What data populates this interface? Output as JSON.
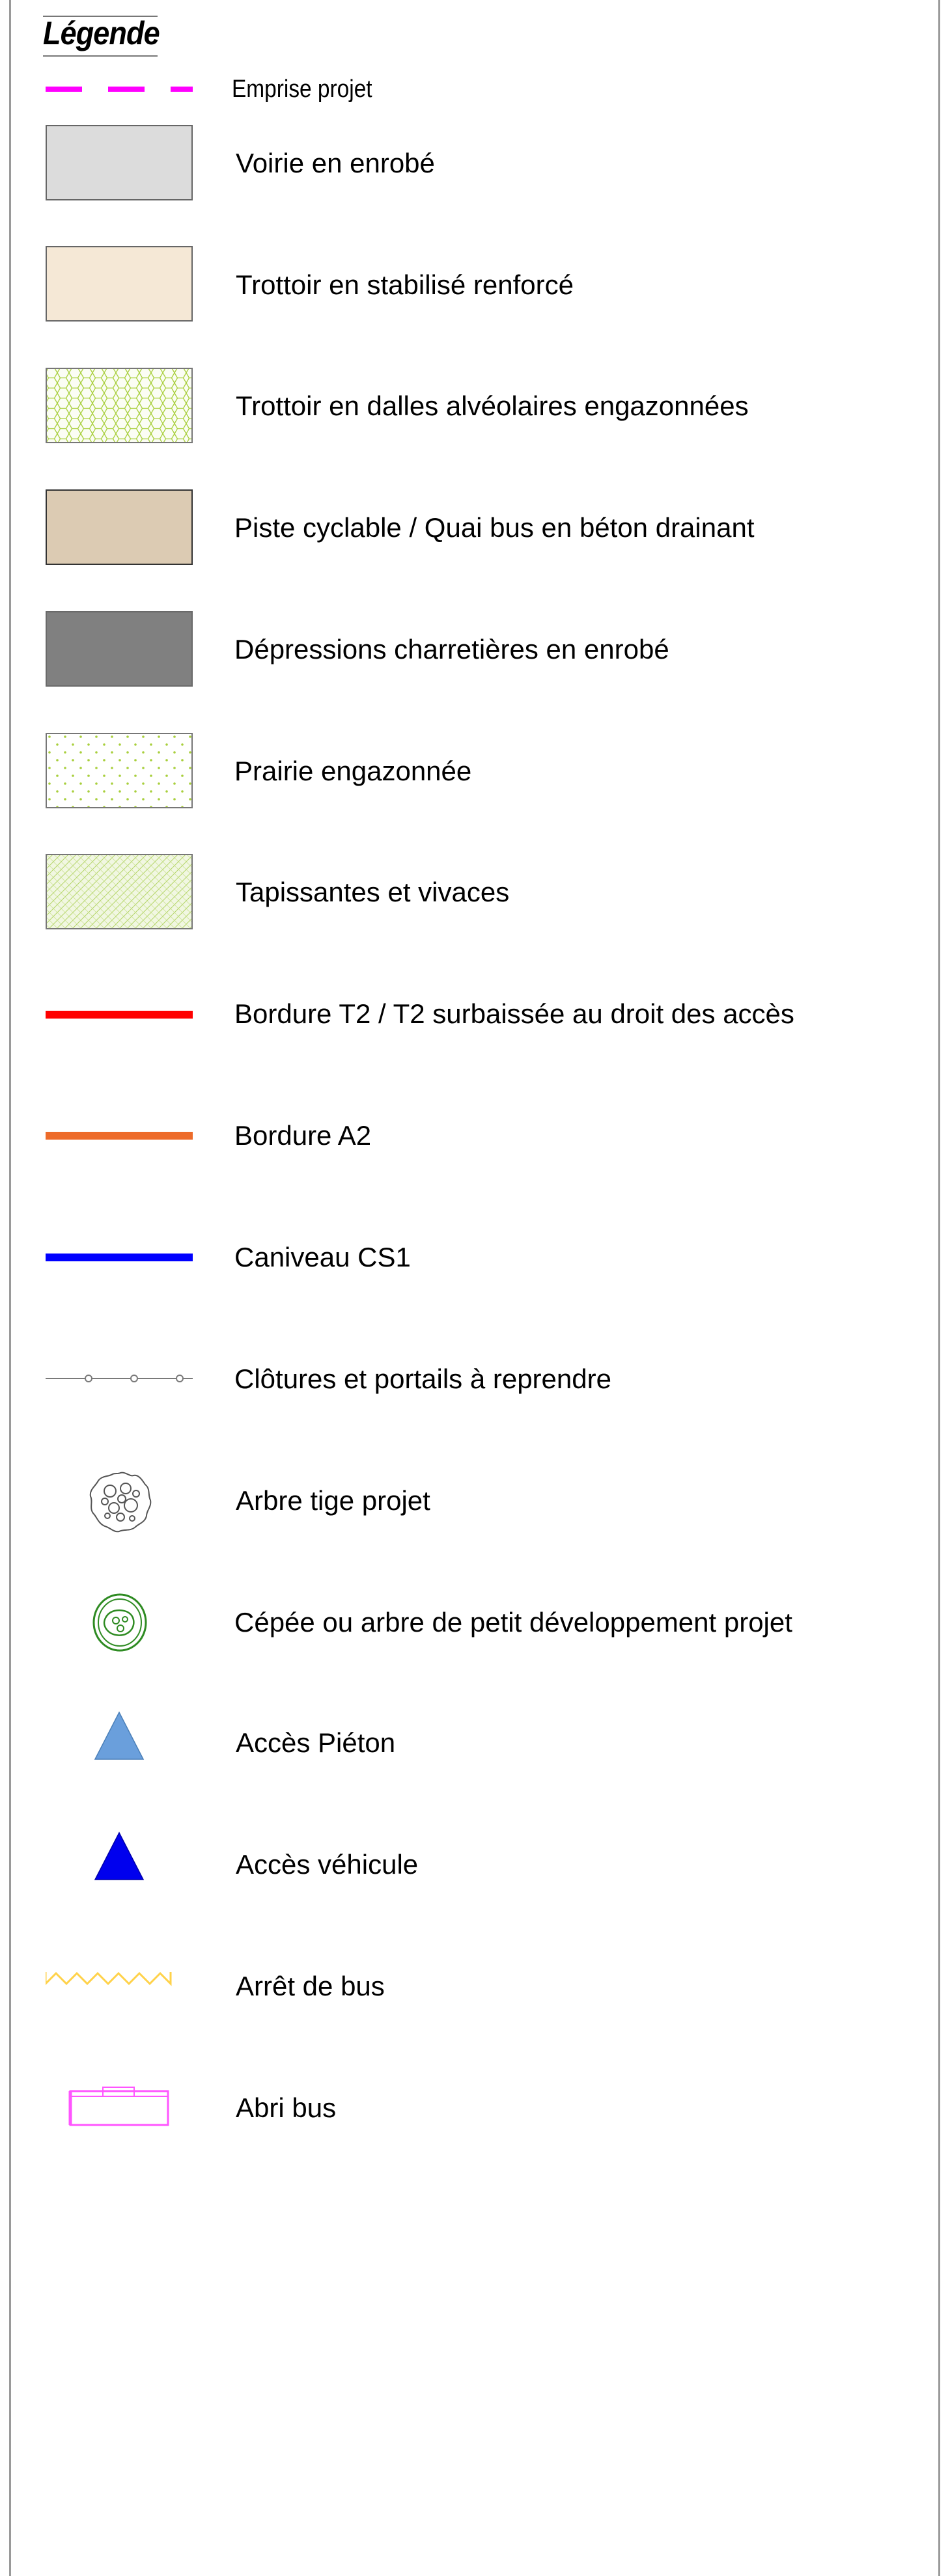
{
  "legend": {
    "title": "Légende",
    "items": [
      {
        "key": "emprise",
        "label": "Emprise projet",
        "color": "#ff00ff"
      },
      {
        "key": "voirie",
        "label": "Voirie en enrobé",
        "color": "#dcdcdc"
      },
      {
        "key": "trottoir-stabilise",
        "label": "Trottoir en stabilisé renforcé",
        "color": "#f5e8d6"
      },
      {
        "key": "trottoir-dalles",
        "label": "Trottoir en dalles alvéolaires engazonnées",
        "color": "#a8cf3c"
      },
      {
        "key": "piste-cyclable",
        "label": "Piste cyclable / Quai bus en béton drainant",
        "color": "#dccbb3"
      },
      {
        "key": "depressions",
        "label": "Dépressions charretières en enrobé",
        "color": "#808080"
      },
      {
        "key": "prairie",
        "label": "Prairie engazonnée",
        "color": "#a8cf3c"
      },
      {
        "key": "tapissantes",
        "label": "Tapissantes et vivaces",
        "color": "#b5d66a"
      },
      {
        "key": "bordure-t2",
        "label": "Bordure T2 / T2 surbaissée au droit des accès",
        "color": "#ff0000"
      },
      {
        "key": "bordure-a2",
        "label": "Bordure A2",
        "color": "#ed6b2a"
      },
      {
        "key": "caniveau",
        "label": "Caniveau CS1",
        "color": "#0000ff"
      },
      {
        "key": "clotures",
        "label": "Clôtures et portails à reprendre",
        "color": "#7a7a7a"
      },
      {
        "key": "arbre-tige",
        "label": "Arbre tige projet",
        "color": "#555555"
      },
      {
        "key": "cepee",
        "label": "Cépée ou arbre de petit développement projet",
        "color": "#2e8b22"
      },
      {
        "key": "acces-pieton",
        "label": "Accès Piéton",
        "color": "#6a9fdc"
      },
      {
        "key": "acces-vehicule",
        "label": "Accès véhicule",
        "color": "#0000ee"
      },
      {
        "key": "arret-bus",
        "label": "Arrêt de bus",
        "color": "#ffd24a"
      },
      {
        "key": "abri-bus",
        "label": "Abri bus",
        "color": "#ff55ff"
      }
    ]
  }
}
